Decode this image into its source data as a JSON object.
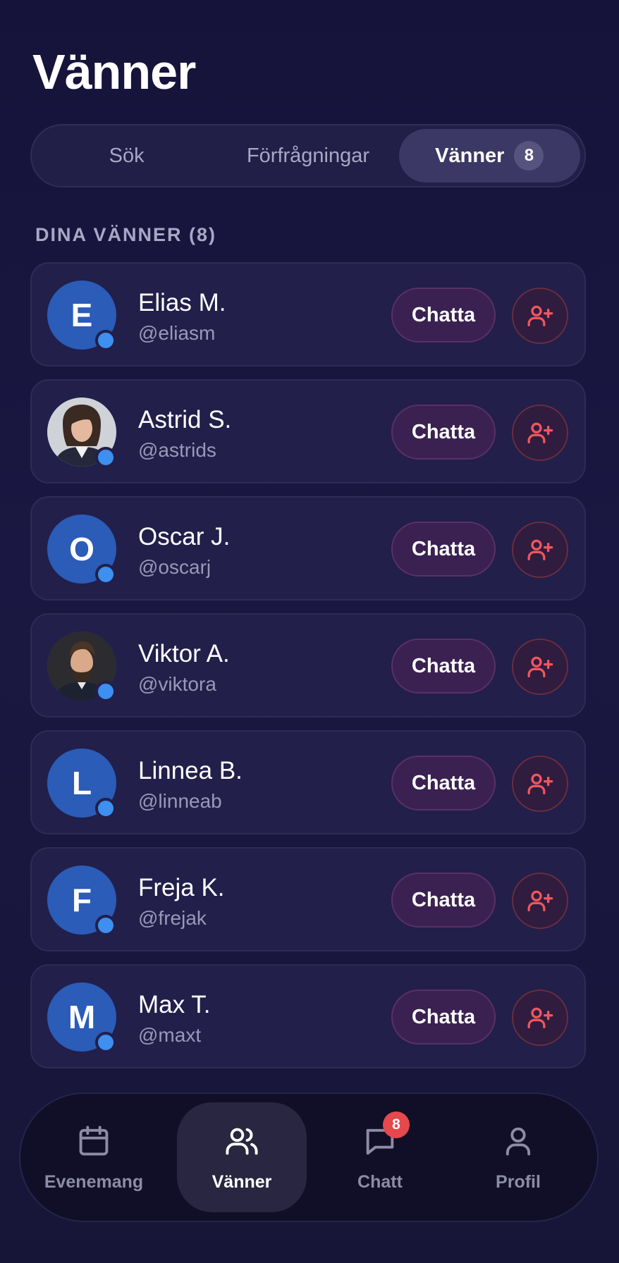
{
  "header": {
    "title": "Vänner"
  },
  "tabs": [
    {
      "label": "Sök"
    },
    {
      "label": "Förfrågningar"
    },
    {
      "label": "Vänner",
      "badge": "8"
    }
  ],
  "section": {
    "title": "DINA VÄNNER (8)"
  },
  "friends": [
    {
      "name": "Elias M.",
      "handle": "@eliasm",
      "initial": "E",
      "avatar": "initial",
      "chat_label": "Chatta"
    },
    {
      "name": "Astrid S.",
      "handle": "@astrids",
      "initial": "",
      "avatar": "photo-woman",
      "chat_label": "Chatta"
    },
    {
      "name": "Oscar J.",
      "handle": "@oscarj",
      "initial": "O",
      "avatar": "initial",
      "chat_label": "Chatta"
    },
    {
      "name": "Viktor A.",
      "handle": "@viktora",
      "initial": "",
      "avatar": "photo-man",
      "chat_label": "Chatta"
    },
    {
      "name": "Linnea B.",
      "handle": "@linneab",
      "initial": "L",
      "avatar": "initial",
      "chat_label": "Chatta"
    },
    {
      "name": "Freja K.",
      "handle": "@frejak",
      "initial": "F",
      "avatar": "initial",
      "chat_label": "Chatta"
    },
    {
      "name": "Max T.",
      "handle": "@maxt",
      "initial": "M",
      "avatar": "initial",
      "chat_label": "Chatta"
    }
  ],
  "nav": {
    "items": [
      {
        "label": "Evenemang",
        "icon": "calendar-icon"
      },
      {
        "label": "Vänner",
        "icon": "users-icon",
        "active": true
      },
      {
        "label": "Chatt",
        "icon": "chat-bubble-icon",
        "badge": "8"
      },
      {
        "label": "Profil",
        "icon": "user-icon"
      }
    ]
  },
  "colors": {
    "background": "#1a1842",
    "card": "#221f4a",
    "online": "#3d8ff0",
    "avatar": "#2a5cb8",
    "chat_button": "#3a2152",
    "add_icon": "#f0555f",
    "badge": "#e5484d"
  }
}
